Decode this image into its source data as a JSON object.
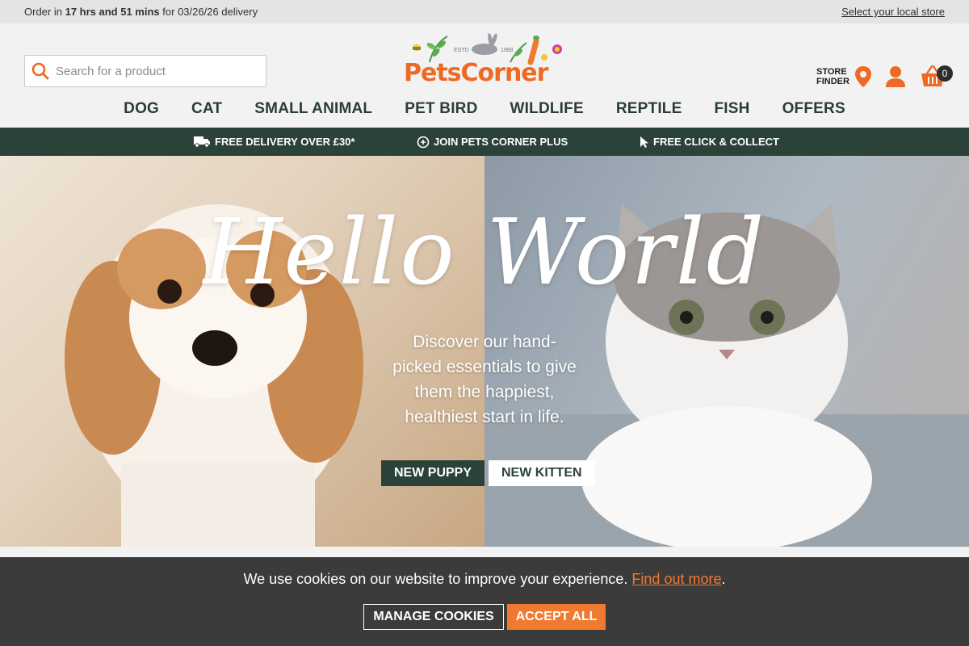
{
  "topbar": {
    "order_prefix": "Order in",
    "countdown": "17 hrs and 51 mins",
    "order_suffix": "for 03/26/26 delivery",
    "store_link": "Select your local store"
  },
  "header": {
    "search_placeholder": "Search for a product",
    "logo": {
      "brand": "PetsCorner",
      "estd": "ESTD",
      "year": "1968"
    },
    "store_finder_line1": "STORE",
    "store_finder_line2": "FINDER",
    "basket_count": "0"
  },
  "nav": {
    "items": [
      "DOG",
      "CAT",
      "SMALL ANIMAL",
      "PET BIRD",
      "WILDLIFE",
      "REPTILE",
      "FISH",
      "OFFERS"
    ]
  },
  "benefits": {
    "delivery": "FREE DELIVERY OVER £30*",
    "plus": "JOIN PETS CORNER PLUS",
    "collect": "FREE CLICK & COLLECT"
  },
  "hero": {
    "title": "Hello World",
    "copy_line1": "Discover our hand-",
    "copy_line2": "picked essentials to give",
    "copy_line3": "them the happiest,",
    "copy_line4": "healthiest start in life.",
    "btn_puppy": "NEW PUPPY",
    "btn_kitten": "NEW KITTEN"
  },
  "cookie": {
    "message": "We use cookies on our website to improve your experience.",
    "link": "Find out more",
    "period": ".",
    "manage": "MANAGE COOKIES",
    "accept": "ACCEPT ALL"
  },
  "colors": {
    "brand_orange": "#ee6a24",
    "brand_green": "#2b4238",
    "cookie_bg": "#3b3b3b"
  }
}
